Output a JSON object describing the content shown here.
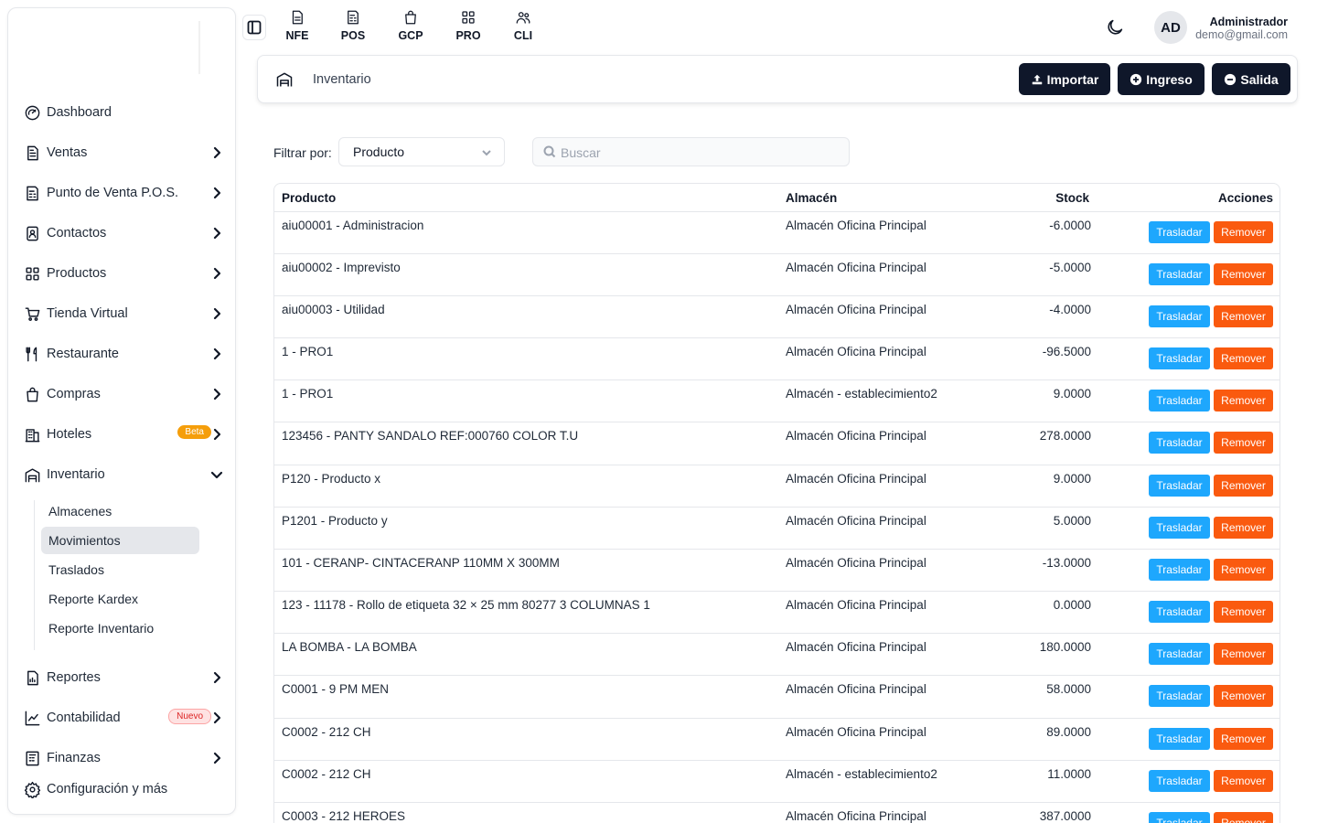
{
  "sidebar": {
    "items": [
      {
        "label": "Dashboard",
        "icon": "dashboard-icon"
      },
      {
        "label": "Ventas",
        "icon": "document-icon"
      },
      {
        "label": "Punto de Venta P.O.S.",
        "icon": "pos-icon"
      },
      {
        "label": "Contactos",
        "icon": "contacts-icon"
      },
      {
        "label": "Productos",
        "icon": "products-icon"
      },
      {
        "label": "Tienda Virtual",
        "icon": "cart-icon"
      },
      {
        "label": "Restaurante",
        "icon": "utensils-icon"
      },
      {
        "label": "Compras",
        "icon": "shopping-bag-icon"
      },
      {
        "label": "Hoteles",
        "icon": "hotel-icon",
        "badge": "Beta"
      },
      {
        "label": "Inventario",
        "icon": "warehouse-icon"
      },
      {
        "label": "Reportes",
        "icon": "report-icon"
      },
      {
        "label": "Contabilidad",
        "icon": "chart-icon",
        "badge": "Nuevo"
      },
      {
        "label": "Finanzas",
        "icon": "finance-icon"
      },
      {
        "label": "Configuración y más",
        "icon": "gear-icon"
      }
    ],
    "inventario_sub": [
      "Almacenes",
      "Movimientos",
      "Traslados",
      "Reporte Kardex",
      "Reporte Inventario"
    ],
    "active_sub": "Movimientos"
  },
  "topbar": {
    "quick": [
      "NFE",
      "POS",
      "GCP",
      "PRO",
      "CLI"
    ],
    "avatar": "AD",
    "user_name": "Administrador",
    "user_email": "demo@gmail.com"
  },
  "header": {
    "title": "Inventario",
    "import_label": "Importar",
    "ingreso_label": "Ingreso",
    "salida_label": "Salida"
  },
  "filter": {
    "label": "Filtrar por:",
    "selected": "Producto",
    "search_placeholder": "Buscar"
  },
  "table": {
    "headers": [
      "Producto",
      "Almacén",
      "Stock",
      "Acciones"
    ],
    "action_move": "Trasladar",
    "action_remove": "Remover",
    "rows": [
      {
        "producto": "aiu00001 - Administracion",
        "almacen": "Almacén Oficina Principal",
        "stock": "-6.0000"
      },
      {
        "producto": "aiu00002 - Imprevisto",
        "almacen": "Almacén Oficina Principal",
        "stock": "-5.0000"
      },
      {
        "producto": "aiu00003 - Utilidad",
        "almacen": "Almacén Oficina Principal",
        "stock": "-4.0000"
      },
      {
        "producto": "1 - PRO1",
        "almacen": "Almacén Oficina Principal",
        "stock": "-96.5000"
      },
      {
        "producto": "1 - PRO1",
        "almacen": "Almacén - establecimiento2",
        "stock": "9.0000"
      },
      {
        "producto": "123456 - PANTY SANDALO REF:000760 COLOR T.U",
        "almacen": "Almacén Oficina Principal",
        "stock": "278.0000"
      },
      {
        "producto": "P120 - Producto x",
        "almacen": "Almacén Oficina Principal",
        "stock": "9.0000"
      },
      {
        "producto": "P1201 - Producto y",
        "almacen": "Almacén Oficina Principal",
        "stock": "5.0000"
      },
      {
        "producto": "101 - CERANP- CINTACERANP 110MM X 300MM",
        "almacen": "Almacén Oficina Principal",
        "stock": "-13.0000"
      },
      {
        "producto": "123 - 11178 - Rollo de etiqueta 32 × 25 mm 80277 3 COLUMNAS 1",
        "almacen": "Almacén Oficina Principal",
        "stock": "0.0000"
      },
      {
        "producto": "LA BOMBA - LA BOMBA",
        "almacen": "Almacén Oficina Principal",
        "stock": "180.0000"
      },
      {
        "producto": "C0001 - 9 PM MEN",
        "almacen": "Almacén Oficina Principal",
        "stock": "58.0000"
      },
      {
        "producto": "C0002 - 212 CH",
        "almacen": "Almacén Oficina Principal",
        "stock": "89.0000"
      },
      {
        "producto": "C0002 - 212 CH",
        "almacen": "Almacén - establecimiento2",
        "stock": "11.0000"
      },
      {
        "producto": "C0003 - 212 HEROES",
        "almacen": "Almacén Oficina Principal",
        "stock": "387.0000"
      }
    ]
  },
  "colors": {
    "primary_dark": "#0f172a",
    "move_blue": "#1ea7fd",
    "remove_orange": "#fa5a0f",
    "beta_badge": "#f59e0b",
    "nuevo_badge": "#dc2626"
  }
}
